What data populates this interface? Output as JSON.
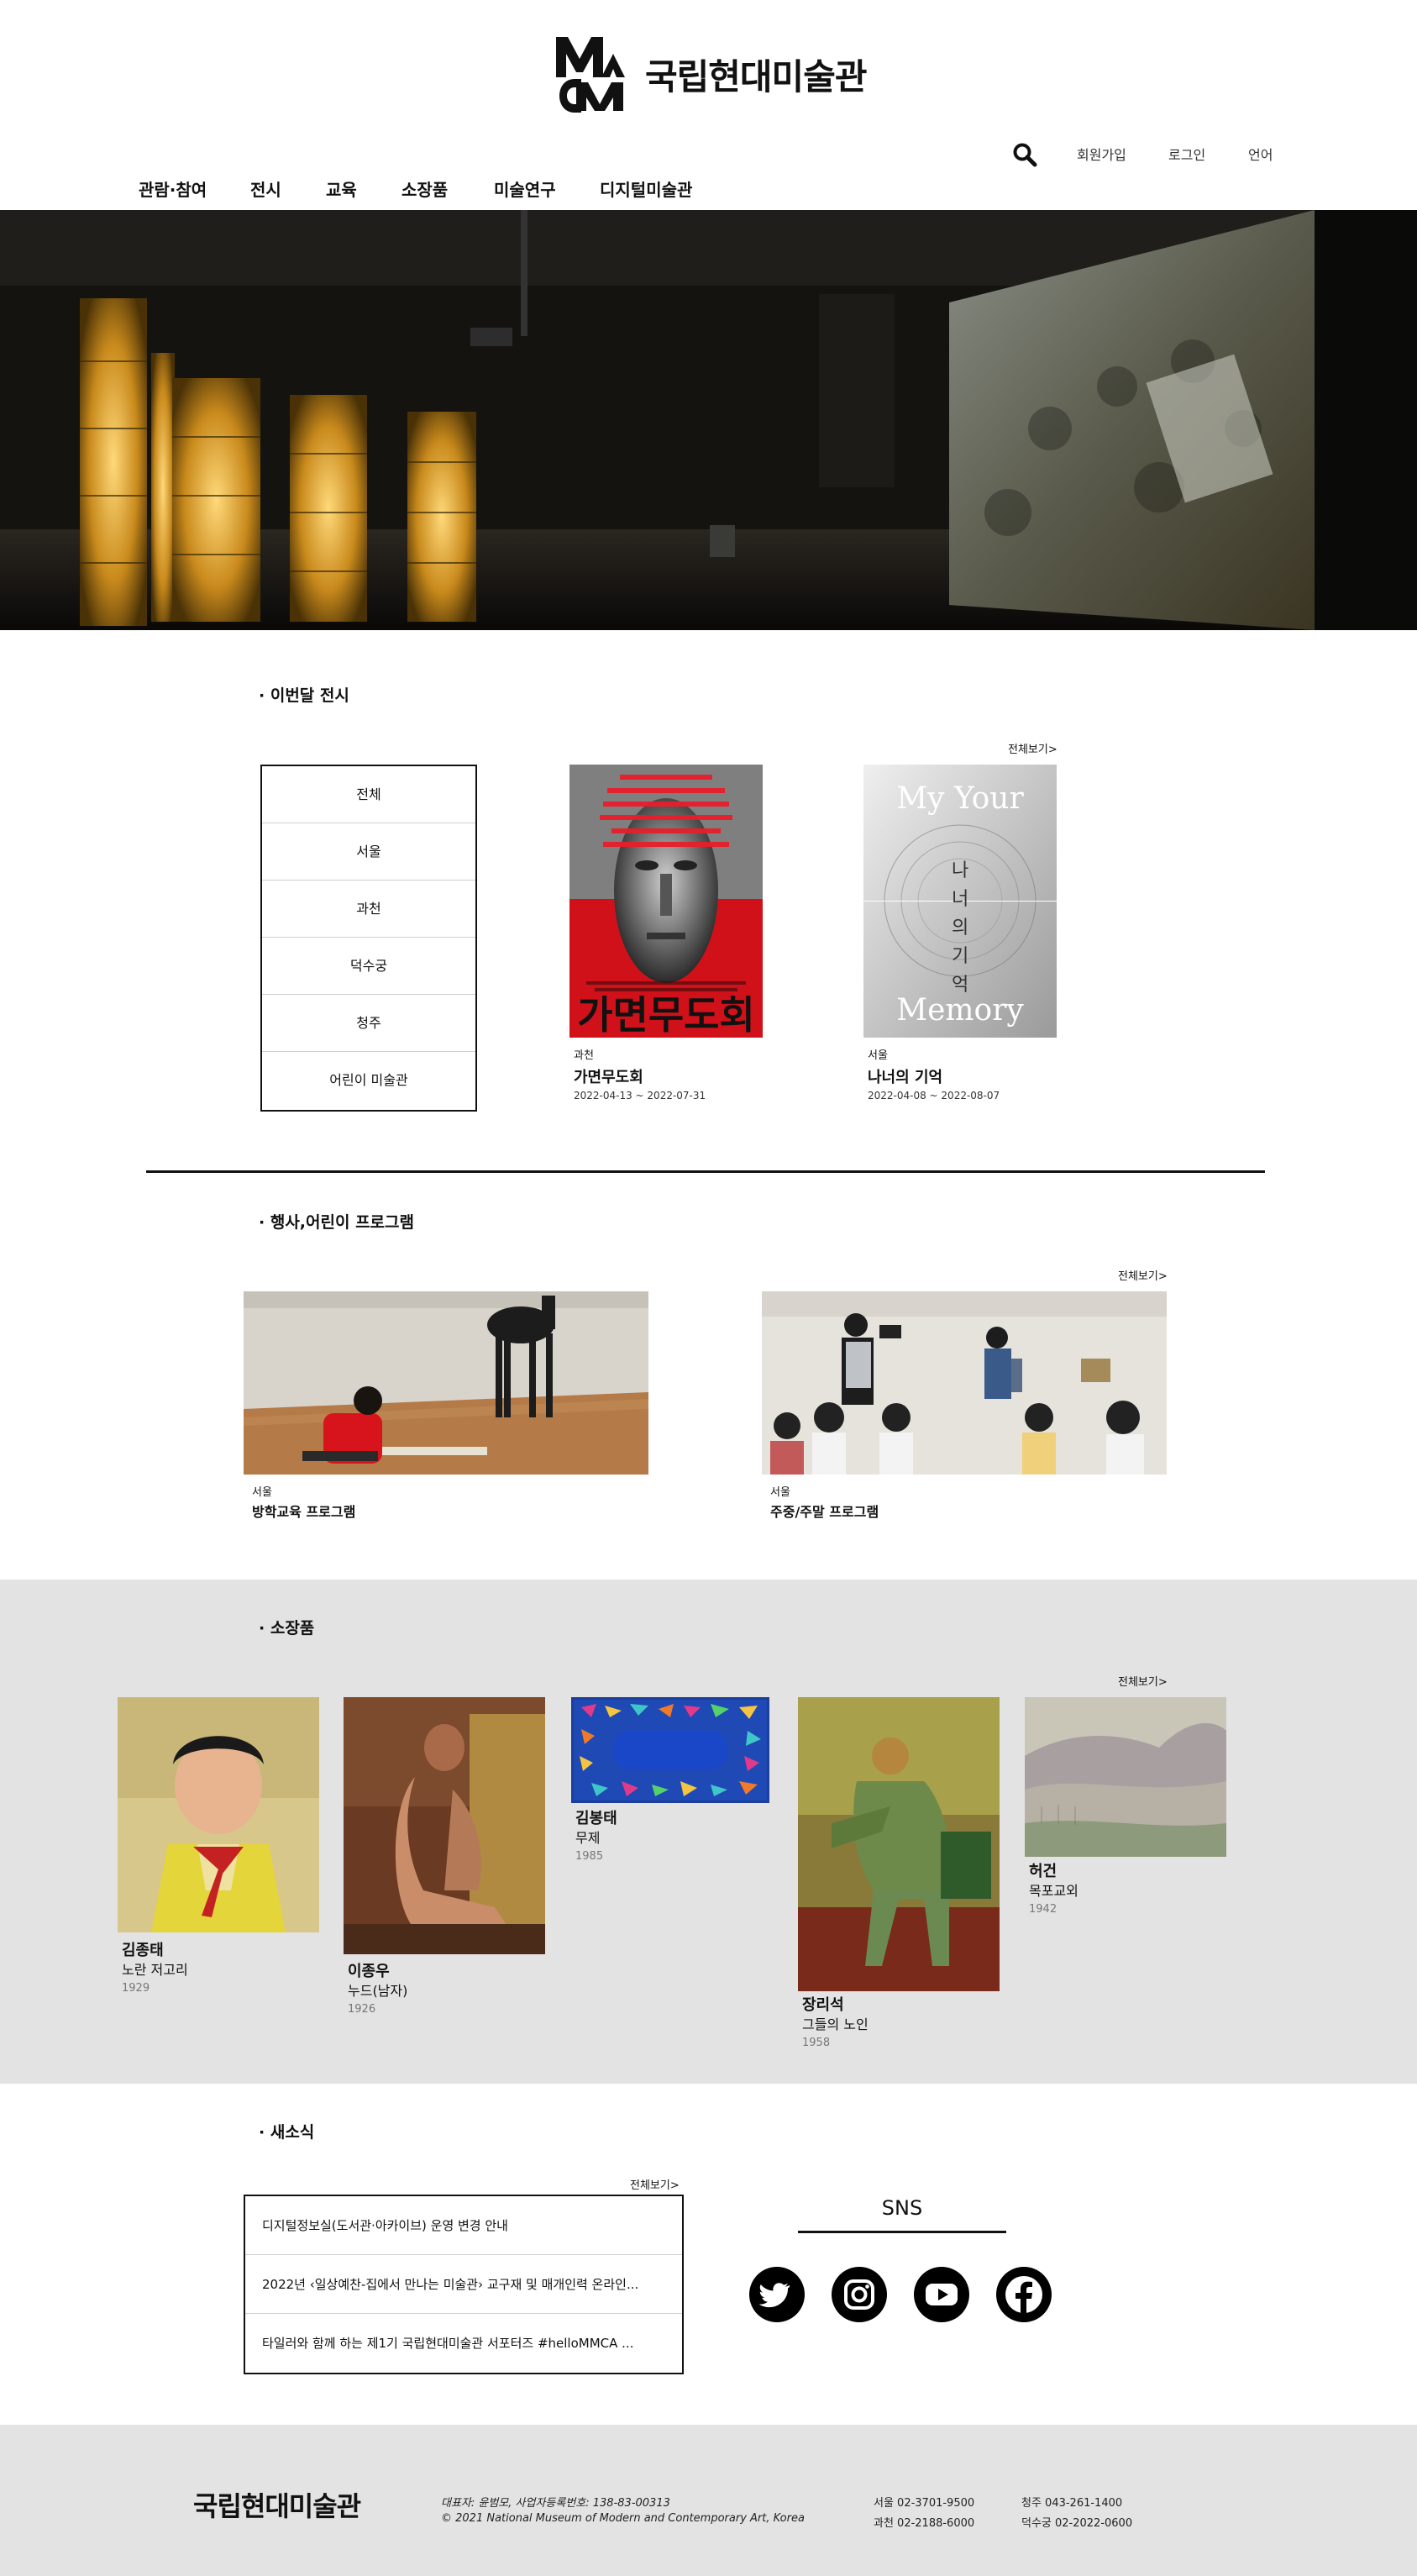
{
  "header": {
    "brand_name": "국립현대미술관",
    "logo_letters": "MMCA",
    "utility": {
      "join": "회원가입",
      "login": "로그인",
      "language": "언어"
    },
    "nav": [
      "관람·참여",
      "전시",
      "교육",
      "소장품",
      "미술연구",
      "디지털미술관"
    ]
  },
  "exhibitions": {
    "title": "· 이번달 전시",
    "view_all": "전체보기>",
    "regions": [
      "전체",
      "서울",
      "과천",
      "덕수궁",
      "청주",
      "어린이 미술관"
    ],
    "items": [
      {
        "venue": "과천",
        "title": "가면무도회",
        "date": "2022-04-13 ~ 2022-07-31",
        "poster_text": "가면무도회"
      },
      {
        "venue": "서울",
        "title": "나너의 기억",
        "date": "2022-04-08 ~ 2022-08-07",
        "poster_text_en_top": "My Your",
        "poster_text_kr": [
          "나",
          "너",
          "의",
          "기",
          "억"
        ],
        "poster_text_en_bottom": "Memory"
      }
    ]
  },
  "programs": {
    "title": "· 행사,어린이 프로그램",
    "view_all": "전체보기>",
    "items": [
      {
        "venue": "서울",
        "title": "방학교육 프로그램"
      },
      {
        "venue": "서울",
        "title": "주중/주말 프로그램"
      }
    ]
  },
  "collection": {
    "title": "· 소장품",
    "view_all": "전체보기>",
    "items": [
      {
        "artist": "김종태",
        "work": "노란 저고리",
        "year": "1929"
      },
      {
        "artist": "이종우",
        "work": "누드(남자)",
        "year": "1926"
      },
      {
        "artist": "김봉태",
        "work": "무제",
        "year": "1985"
      },
      {
        "artist": "장리석",
        "work": "그들의 노인",
        "year": "1958"
      },
      {
        "artist": "허건",
        "work": "목포교외",
        "year": "1942"
      }
    ]
  },
  "news": {
    "title": "· 새소식",
    "view_all": "전체보기>",
    "items": [
      "디지털정보실(도서관·아카이브) 운영 변경 안내",
      "2022년 ‹일상예찬-집에서 만나는 미술관› 교구재 및 매개인력 온라인...",
      "타일러와 함께 하는 제1기 국립현대미술관 서포터즈 #helloMMCA ..."
    ]
  },
  "sns": {
    "title": "SNS",
    "icons": [
      "twitter-icon",
      "instagram-icon",
      "youtube-icon",
      "facebook-icon"
    ]
  },
  "footer": {
    "brand": "국립현대미술관",
    "info_line1": "대표자: 윤범모, 사업자등록번호: 138-83-00313",
    "info_line2": "© 2021 National Museum of Modern and Contemporary Art, Korea",
    "phones": {
      "seoul": "서울 02-3701-9500",
      "gwacheon": "과천 02-2188-6000",
      "cheongju": "청주 043-261-1400",
      "deoksugung": "덕수궁 02-2022-0600"
    }
  }
}
